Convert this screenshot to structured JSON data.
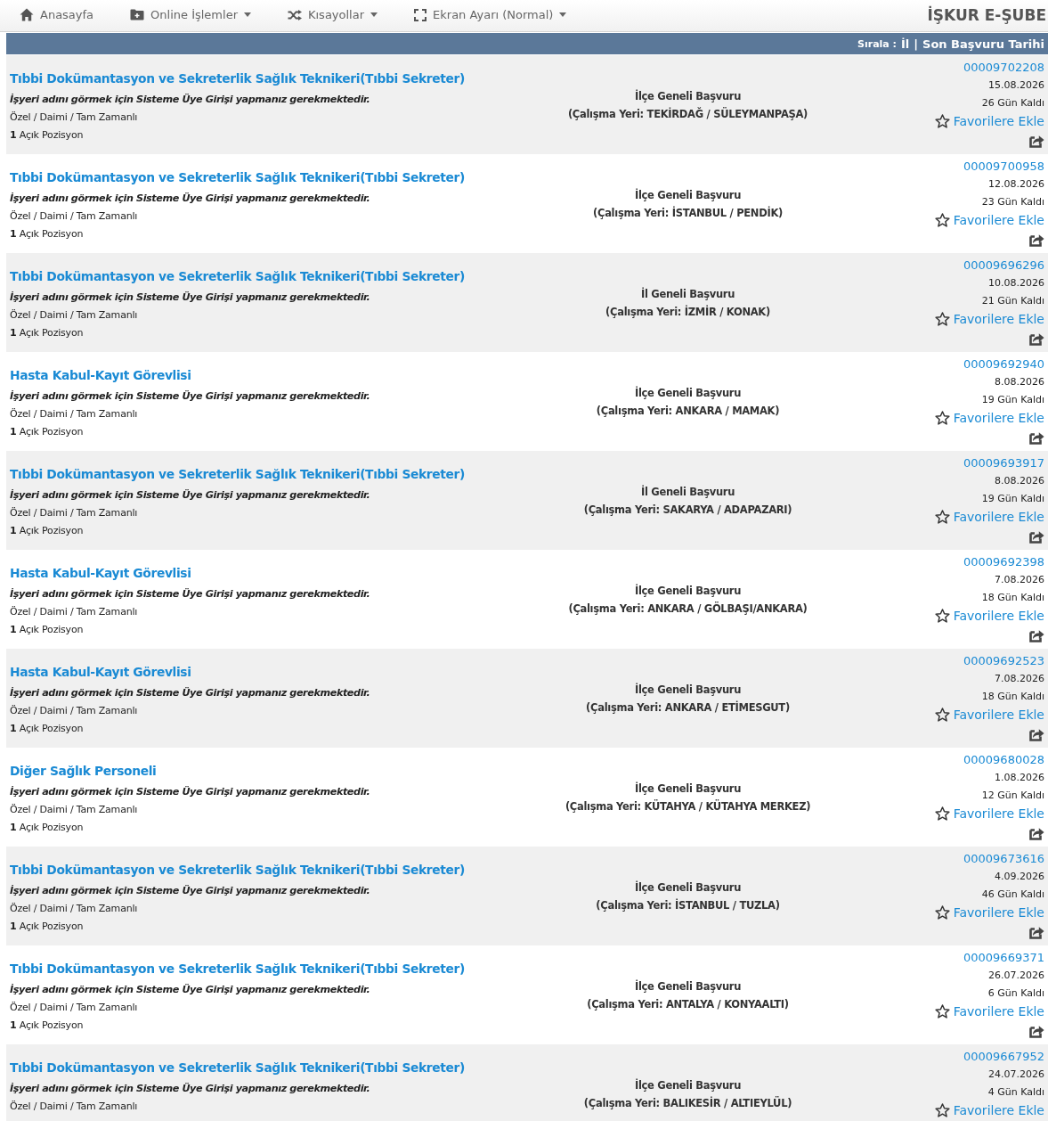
{
  "navbar": {
    "items": [
      {
        "kind": "home",
        "label": "Anasayfa",
        "dropdown": false
      },
      {
        "kind": "folder",
        "label": "Online İşlemler",
        "dropdown": true
      },
      {
        "kind": "shuffle",
        "label": "Kısayollar",
        "dropdown": true
      },
      {
        "kind": "fullscreen",
        "label": "Ekran Ayarı (Normal)",
        "dropdown": true
      }
    ],
    "brand": "İŞKUR E-ŞUBE"
  },
  "sort_bar": {
    "label": "Sırala :",
    "options": [
      "İl",
      "Son Başvuru Tarihi"
    ],
    "separator": "|"
  },
  "jobs": [
    {
      "title": "Tıbbi Dokümantasyon ve Sekreterlik Sağlık Teknikeri(Tıbbi Sekreter)",
      "employer_note": "İşyeri adını görmek için Sisteme Üye Girişi yapmanız gerekmektedir.",
      "job_type": "Özel / Daimi / Tam Zamanlı",
      "positions": "**1** Açık Pozisyon",
      "scope": "İlçe Geneli Başvuru",
      "location": "(Çalışma Yeri: TEKİRDAĞ / SÜLEYMANPAŞA)",
      "number": "00009702208",
      "deadline": "15.08.2026",
      "days_left": "26 Gün Kaldı",
      "favorite": "Favorilere Ekle",
      "share": true
    },
    {
      "title": "Tıbbi Dokümantasyon ve Sekreterlik Sağlık Teknikeri(Tıbbi Sekreter)",
      "employer_note": "İşyeri adını görmek için Sisteme Üye Girişi yapmanız gerekmektedir.",
      "job_type": "Özel / Daimi / Tam Zamanlı",
      "positions": "**1** Açık Pozisyon",
      "scope": "İlçe Geneli Başvuru",
      "location": "(Çalışma Yeri: İSTANBUL / PENDİK)",
      "number": "00009700958",
      "deadline": "12.08.2026",
      "days_left": "23 Gün Kaldı",
      "favorite": "Favorilere Ekle",
      "share": true
    },
    {
      "title": "Tıbbi Dokümantasyon ve Sekreterlik Sağlık Teknikeri(Tıbbi Sekreter)",
      "employer_note": "İşyeri adını görmek için Sisteme Üye Girişi yapmanız gerekmektedir.",
      "job_type": "Özel / Daimi / Tam Zamanlı",
      "positions": "**1** Açık Pozisyon",
      "scope": "İl Geneli Başvuru",
      "location": "(Çalışma Yeri: İZMİR / KONAK)",
      "number": "00009696296",
      "deadline": "10.08.2026",
      "days_left": "21 Gün Kaldı",
      "favorite": "Favorilere Ekle",
      "share": true
    },
    {
      "title": "Hasta Kabul-Kayıt Görevlisi",
      "employer_note": "İşyeri adını görmek için Sisteme Üye Girişi yapmanız gerekmektedir.",
      "job_type": "Özel / Daimi / Tam Zamanlı",
      "positions": "**1** Açık Pozisyon",
      "scope": "İlçe Geneli Başvuru",
      "location": "(Çalışma Yeri: ANKARA / MAMAK)",
      "number": "00009692940",
      "deadline": "8.08.2026",
      "days_left": "19 Gün Kaldı",
      "favorite": "Favorilere Ekle",
      "share": true
    },
    {
      "title": "Tıbbi Dokümantasyon ve Sekreterlik Sağlık Teknikeri(Tıbbi Sekreter)",
      "employer_note": "İşyeri adını görmek için Sisteme Üye Girişi yapmanız gerekmektedir.",
      "job_type": "Özel / Daimi / Tam Zamanlı",
      "positions": "**1** Açık Pozisyon",
      "scope": "İl Geneli Başvuru",
      "location": "(Çalışma Yeri: SAKARYA / ADAPAZARI)",
      "number": "00009693917",
      "deadline": "8.08.2026",
      "days_left": "19 Gün Kaldı",
      "favorite": "Favorilere Ekle",
      "share": true
    },
    {
      "title": "Hasta Kabul-Kayıt Görevlisi",
      "employer_note": "İşyeri adını görmek için Sisteme Üye Girişi yapmanız gerekmektedir.",
      "job_type": "Özel / Daimi / Tam Zamanlı",
      "positions": "**1** Açık Pozisyon",
      "scope": "İlçe Geneli Başvuru",
      "location": "(Çalışma Yeri: ANKARA / GÖLBAŞI/ANKARA)",
      "number": "00009692398",
      "deadline": "7.08.2026",
      "days_left": "18 Gün Kaldı",
      "favorite": "Favorilere Ekle",
      "share": true
    },
    {
      "title": "Hasta Kabul-Kayıt Görevlisi",
      "employer_note": "İşyeri adını görmek için Sisteme Üye Girişi yapmanız gerekmektedir.",
      "job_type": "Özel / Daimi / Tam Zamanlı",
      "positions": "**1** Açık Pozisyon",
      "scope": "İlçe Geneli Başvuru",
      "location": "(Çalışma Yeri: ANKARA / ETİMESGUT)",
      "number": "00009692523",
      "deadline": "7.08.2026",
      "days_left": "18 Gün Kaldı",
      "favorite": "Favorilere Ekle",
      "share": true
    },
    {
      "title": "Diğer Sağlık Personeli",
      "employer_note": "İşyeri adını görmek için Sisteme Üye Girişi yapmanız gerekmektedir.",
      "job_type": "Özel / Daimi / Tam Zamanlı",
      "positions": "**1** Açık Pozisyon",
      "scope": "İlçe Geneli Başvuru",
      "location": "(Çalışma Yeri: KÜTAHYA / KÜTAHYA MERKEZ)",
      "number": "00009680028",
      "deadline": "1.08.2026",
      "days_left": "12 Gün Kaldı",
      "favorite": "Favorilere Ekle",
      "share": true
    },
    {
      "title": "Tıbbi Dokümantasyon ve Sekreterlik Sağlık Teknikeri(Tıbbi Sekreter)",
      "employer_note": "İşyeri adını görmek için Sisteme Üye Girişi yapmanız gerekmektedir.",
      "job_type": "Özel / Daimi / Tam Zamanlı",
      "positions": "**1** Açık Pozisyon",
      "scope": "İlçe Geneli Başvuru",
      "location": "(Çalışma Yeri: İSTANBUL / TUZLA)",
      "number": "00009673616",
      "deadline": "4.09.2026",
      "days_left": "46 Gün Kaldı",
      "favorite": "Favorilere Ekle",
      "share": true
    },
    {
      "title": "Tıbbi Dokümantasyon ve Sekreterlik Sağlık Teknikeri(Tıbbi Sekreter)",
      "employer_note": "İşyeri adını görmek için Sisteme Üye Girişi yapmanız gerekmektedir.",
      "job_type": "Özel / Daimi / Tam Zamanlı",
      "positions": "**1** Açık Pozisyon",
      "scope": "İlçe Geneli Başvuru",
      "location": "(Çalışma Yeri: ANTALYA / KONYAALTI)",
      "number": "00009669371",
      "deadline": "26.07.2026",
      "days_left": "6 Gün Kaldı",
      "favorite": "Favorilere Ekle",
      "share": true
    },
    {
      "title": "Tıbbi Dokümantasyon ve Sekreterlik Sağlık Teknikeri(Tıbbi Sekreter)",
      "employer_note": "İşyeri adını görmek için Sisteme Üye Girişi yapmanız gerekmektedir.",
      "job_type": "Özel / Daimi / Tam Zamanlı",
      "scope": "İlçe Geneli Başvuru",
      "location": "(Çalışma Yeri: BALIKESİR / ALTIEYLÜL)",
      "number": "00009667952",
      "deadline": "24.07.2026",
      "days_left": "4 Gün Kaldı",
      "favorite": "Favorilere Ekle",
      "share": false
    }
  ]
}
